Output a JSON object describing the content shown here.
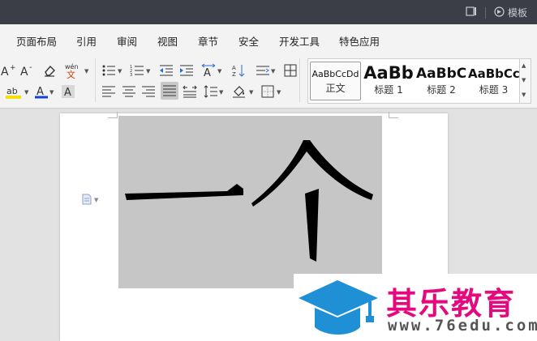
{
  "titlebar": {
    "template_label": "模板",
    "icons": [
      "panel-toggle-icon",
      "template-icon"
    ]
  },
  "menu": {
    "items": [
      "页面布局",
      "引用",
      "审阅",
      "视图",
      "章节",
      "安全",
      "开发工具",
      "特色应用"
    ]
  },
  "ribbon": {
    "pinyin_label": "wén",
    "text_color_letter": "A",
    "icons": [
      "grow-font-icon",
      "shrink-font-icon",
      "clear-format-icon",
      "phonetic-guide-icon",
      "bullet-list-icon",
      "numbered-list-icon",
      "decrease-indent-icon",
      "increase-indent-icon",
      "text-direction-icon",
      "sort-icon",
      "line-spacing-rules-icon",
      "show-hide-marks-icon",
      "highlight-icon",
      "font-color-icon",
      "char-shading-icon",
      "align-left-icon",
      "align-center-icon",
      "align-right-icon",
      "justify-icon",
      "distributed-icon",
      "line-spacing-icon",
      "paragraph-shading-icon",
      "borders-icon"
    ],
    "colors": {
      "highlight": "#f5e000",
      "font_color": "#1a3fd4"
    }
  },
  "styles": {
    "items": [
      {
        "preview": "AaBbCcDd",
        "name": "正文"
      },
      {
        "preview": "AaBb",
        "name": "标题 1"
      },
      {
        "preview": "AaBbC",
        "name": "标题 2"
      },
      {
        "preview": "AaBbCc",
        "name": "标题 3"
      }
    ],
    "selected": "正文"
  },
  "document": {
    "image_text": "一个",
    "image_bg": "#c6c6c6"
  },
  "watermark": {
    "title": "其乐教育",
    "url": "www.76edu.com",
    "colors": {
      "cap": "#1f8fd6",
      "title": "#e4097d",
      "url": "#555555"
    }
  }
}
